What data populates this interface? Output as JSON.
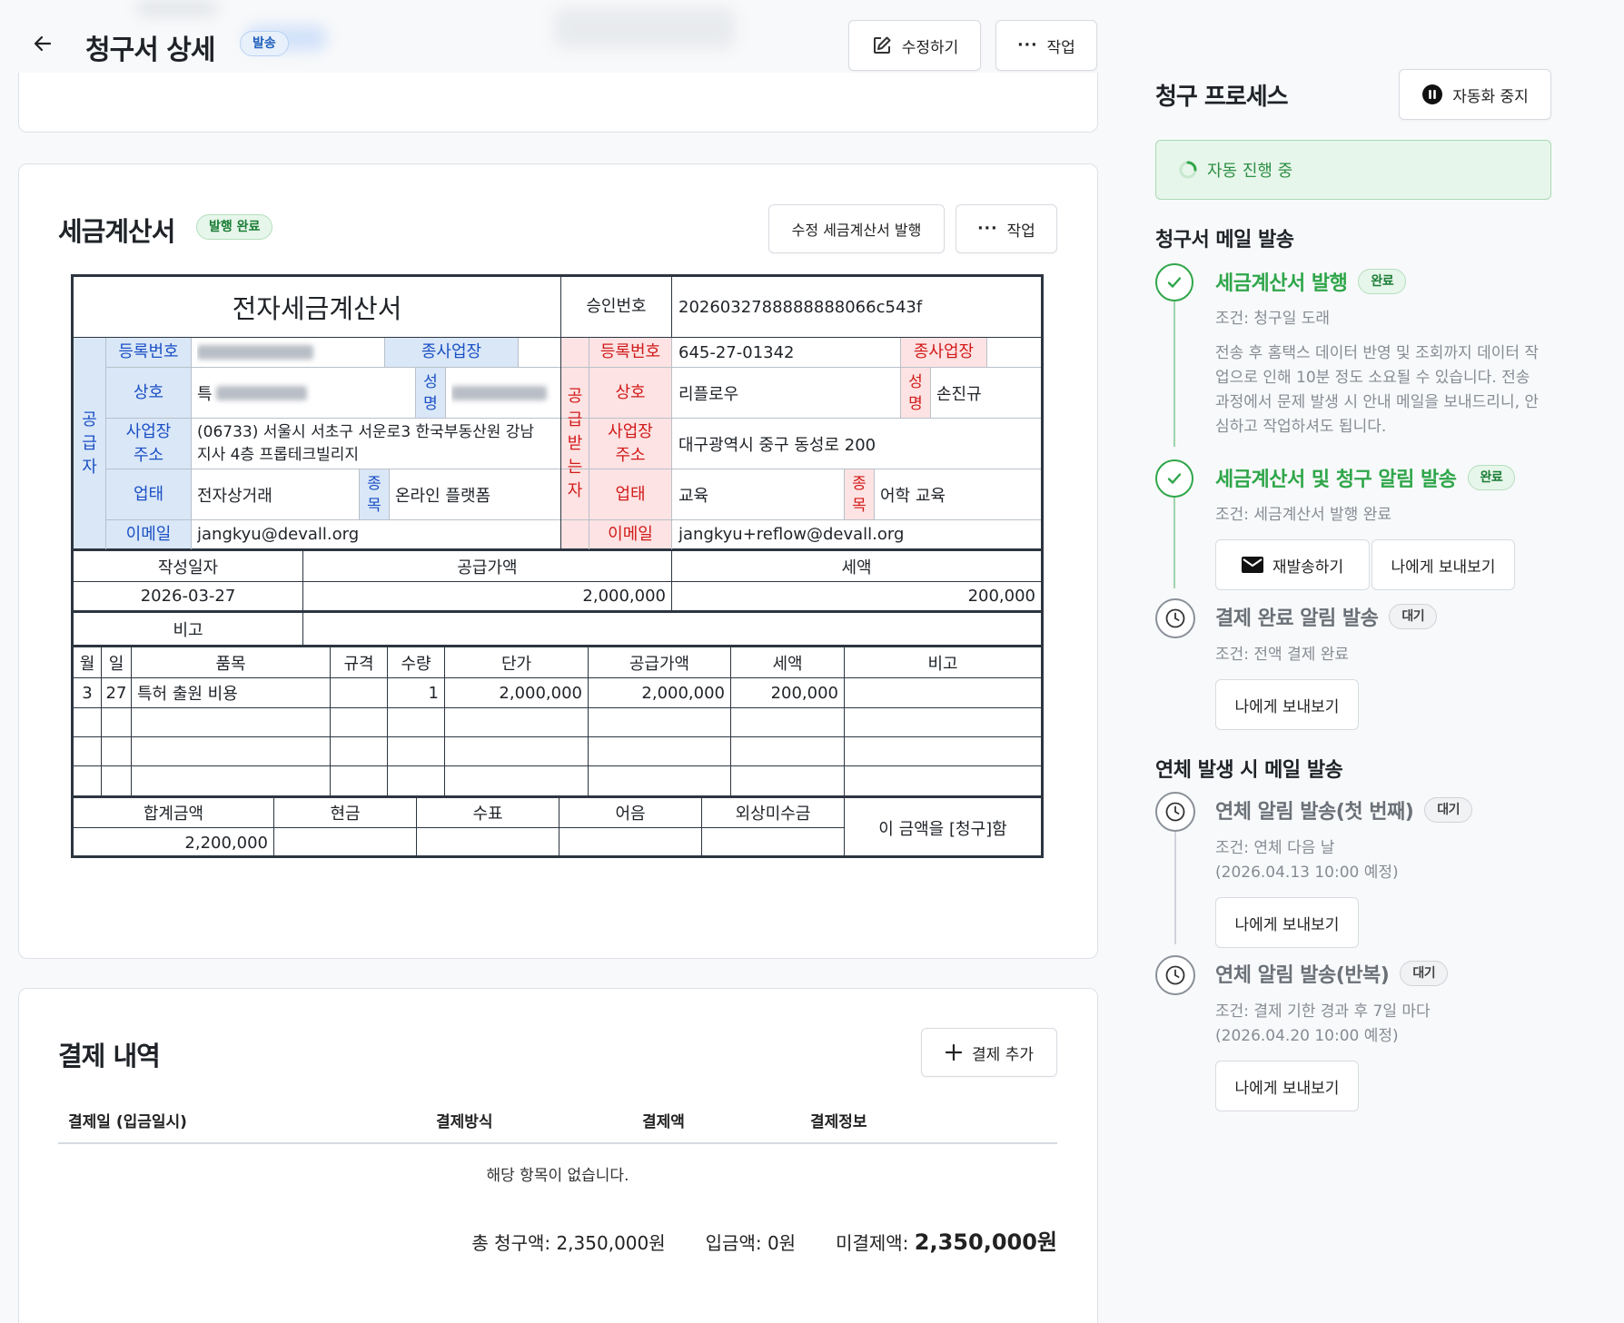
{
  "header": {
    "back_icon": "arrow-left-icon",
    "title": "청구서 상세",
    "status_badge": "발송",
    "edit_label": "수정하기",
    "action_label": "작업"
  },
  "tax_invoice": {
    "title": "세금계산서",
    "status_badge": "발행 완료",
    "reissue_label": "수정 세금계산서 발행",
    "action_label": "작업",
    "doc": {
      "title": "전자세금계산서",
      "approval_label": "승인번호",
      "approval_no": "2026032788888888066c543f",
      "supplier_label": "공급자",
      "buyer_label": "공급받는자",
      "reg_label": "등록번호",
      "branch_label": "종사업장",
      "company_label": "상호",
      "name_label": "성명",
      "address_label": "사업장주소",
      "type_label": "업태",
      "item_label": "종목",
      "email_label": "이메일",
      "supplier": {
        "company_prefix": "특",
        "address_line1": "(06733) 서울시 서초구 서운로3 한국부동산원 강남",
        "address_line2": "지사 4층 프롭테크빌리지",
        "biz_type": "전자상거래",
        "biz_item": "온라인 플랫폼",
        "email": "jangkyu@devall.org"
      },
      "buyer": {
        "reg_no": "645-27-01342",
        "company": "리플로우",
        "name": "손진규",
        "address": "대구광역시 중구 동성로 200",
        "biz_type": "교육",
        "biz_item": "어학 교육",
        "email": "jangkyu+reflow@devall.org"
      },
      "summary_headers": [
        "작성일자",
        "공급가액",
        "세액"
      ],
      "summary_values": [
        "2026-03-27",
        "2,000,000",
        "200,000"
      ],
      "remark_label": "비고",
      "item_headers": [
        "월",
        "일",
        "품목",
        "규격",
        "수량",
        "단가",
        "공급가액",
        "세액",
        "비고"
      ],
      "items": [
        {
          "month": "3",
          "day": "27",
          "name": "특허 출원 비용",
          "spec": "",
          "qty": "1",
          "unit_price": "2,000,000",
          "supply": "2,000,000",
          "tax": "200,000",
          "note": ""
        }
      ],
      "total_headers": [
        "합계금액",
        "현금",
        "수표",
        "어음",
        "외상미수금"
      ],
      "total_value": "2,200,000",
      "claim_text": "이 금액을 [청구]함"
    }
  },
  "payments": {
    "title": "결제 내역",
    "add_label": "결제 추가",
    "columns": [
      "결제일 (입금일시)",
      "결제방식",
      "결제액",
      "결제정보"
    ],
    "empty_text": "해당 항목이 없습니다.",
    "total_label": "총 청구액: 2,350,000원",
    "paid_label": "입금액: 0원",
    "unpaid_prefix": "미결제액:",
    "unpaid_value": "2,350,000원"
  },
  "process": {
    "title": "청구 프로세스",
    "pause_label": "자동화 중지",
    "auto_status": "자동 진행 중",
    "section1": "청구서 메일 발송",
    "section2": "연체 발생 시 메일 발송",
    "resend_label": "재발송하기",
    "send_me_label": "나에게 보내보기",
    "steps": [
      {
        "title": "세금계산서 발행",
        "badge": "완료",
        "cond": "조건: 청구일 도래",
        "desc": [
          "전송 후 홈택스 데이터 반영 및 조회까지 데이터 작",
          "업으로 인해 10분 정도 소요될 수 있습니다. 전송",
          "과정에서 문제 발생 시 안내 메일을 보내드리니, 안",
          "심하고 작업하셔도 됩니다."
        ]
      },
      {
        "title": "세금계산서 및 청구 알림 발송",
        "badge": "완료",
        "cond": "조건: 세금계산서 발행 완료"
      },
      {
        "title": "결제 완료 알림 발송",
        "badge": "대기",
        "cond": "조건: 전액 결제 완료"
      },
      {
        "title": "연체 알림 발송(첫 번째)",
        "badge": "대기",
        "cond": "조건: 연체 다음 날",
        "cond2": "(2026.04.13 10:00 예정)"
      },
      {
        "title": "연체 알림 발송(반복)",
        "badge": "대기",
        "cond": "조건: 결제 기한 경과 후 7일 마다",
        "cond2": "(2026.04.20 10:00 예정)"
      }
    ]
  },
  "colors": {
    "supplier_bg": "#d9e7f7",
    "buyer_bg": "#fde3e3",
    "success": "#2fa64a",
    "accent_blue": "#1b4fc4",
    "accent_red": "#d21a1a"
  }
}
